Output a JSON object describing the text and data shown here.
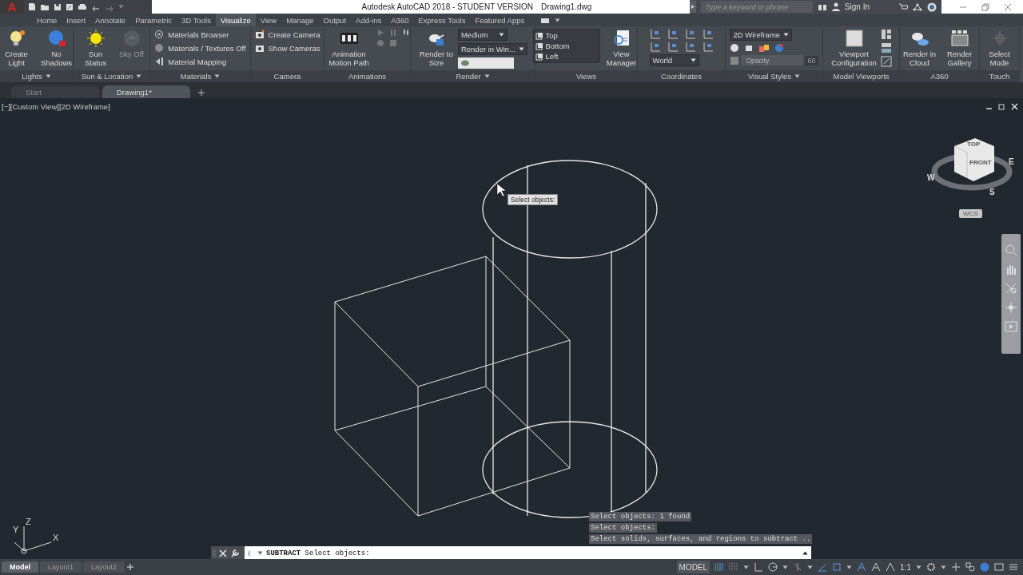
{
  "title_bar": {
    "app_button": "A",
    "title": "Autodesk AutoCAD 2018 - STUDENT VERSION",
    "file_name": "Drawing1.dwg",
    "search": {
      "placeholder": "Type a keyword or phrase"
    },
    "sign_in": "Sign In"
  },
  "ribbon_tabs": [
    {
      "label": "Home",
      "selected": false
    },
    {
      "label": "Insert",
      "selected": false
    },
    {
      "label": "Annotate",
      "selected": false
    },
    {
      "label": "Parametric",
      "selected": false
    },
    {
      "label": "3D Tools",
      "selected": false
    },
    {
      "label": "Visualize",
      "selected": true
    },
    {
      "label": "View",
      "selected": false
    },
    {
      "label": "Manage",
      "selected": false
    },
    {
      "label": "Output",
      "selected": false
    },
    {
      "label": "Add-ins",
      "selected": false
    },
    {
      "label": "A360",
      "selected": false
    },
    {
      "label": "Express Tools",
      "selected": false
    },
    {
      "label": "Featured Apps",
      "selected": false
    }
  ],
  "ribbon_panels": [
    {
      "title": "Lights",
      "menu": true,
      "items": [
        {
          "kind": "large",
          "label": "Create Light",
          "disabled": false
        },
        {
          "kind": "large",
          "label": "No Shadows",
          "disabled": false
        }
      ]
    },
    {
      "title": "Sun & Location",
      "menu": true,
      "items": [
        {
          "kind": "large",
          "label": "Sun Status",
          "disabled": false
        },
        {
          "kind": "large",
          "label": "Sky Off",
          "disabled": true
        }
      ]
    },
    {
      "title": "Materials",
      "menu": true,
      "items": [
        {
          "kind": "small",
          "label": "Materials Browser",
          "disabled": false
        },
        {
          "kind": "small",
          "label": "Materials / Textures Off",
          "disabled": false
        },
        {
          "kind": "small",
          "label": "Material Mapping",
          "disabled": false
        }
      ]
    },
    {
      "title": "Camera",
      "menu": false,
      "items": [
        {
          "kind": "small",
          "label": "Create Camera",
          "disabled": false
        },
        {
          "kind": "small",
          "label": "Show Cameras",
          "disabled": false
        }
      ]
    },
    {
      "title": "Animations",
      "menu": false,
      "items": [
        {
          "kind": "large",
          "label": "Animation Motion Path",
          "disabled": false
        },
        {
          "kind": "playback"
        }
      ]
    },
    {
      "title": "Render",
      "menu": true,
      "items": [
        {
          "kind": "large",
          "label": "Render to Size",
          "disabled": false
        },
        {
          "kind": "dropdown",
          "value": "Medium",
          "disabled": false
        },
        {
          "kind": "dropdown",
          "value": "Render in Win...",
          "disabled": false
        },
        {
          "kind": "field"
        }
      ]
    },
    {
      "title": "Views",
      "menu": false,
      "items": [
        {
          "kind": "list",
          "entries": [
            "Top",
            "Bottom",
            "Left"
          ]
        },
        {
          "kind": "large",
          "label": "View Manager",
          "disabled": false
        }
      ]
    },
    {
      "title": "Coordinates",
      "menu": false,
      "items": [
        {
          "kind": "axes_grid"
        },
        {
          "kind": "dropdown",
          "value": "World",
          "disabled": false
        }
      ]
    },
    {
      "title": "Visual Styles",
      "menu": true,
      "items": [
        {
          "kind": "dropdown",
          "value": "2D Wireframe",
          "disabled": false
        },
        {
          "kind": "style_icons"
        },
        {
          "kind": "slider",
          "label": "Opacity",
          "reading": "60",
          "disabled": true
        }
      ]
    },
    {
      "title": "Model Viewports",
      "menu": false,
      "items": [
        {
          "kind": "large",
          "label": "Viewport Configuration",
          "disabled": false
        },
        {
          "kind": "icon_column"
        }
      ]
    },
    {
      "title": "A360",
      "menu": false,
      "items": [
        {
          "kind": "large",
          "label": "Render in Cloud",
          "disabled": false
        },
        {
          "kind": "large",
          "label": "Render Gallery",
          "disabled": false
        }
      ]
    },
    {
      "title": "Touch",
      "menu": false,
      "items": [
        {
          "kind": "large",
          "label": "Select Mode",
          "disabled": false
        }
      ]
    }
  ],
  "file_tabs": [
    {
      "label": "Start",
      "selected": false
    },
    {
      "label": "Drawing1*",
      "selected": true
    }
  ],
  "viewport": {
    "label": "[−][Custom View][2D Wireframe]",
    "tooltip": "Select objects:",
    "view_cube": {
      "faces": [
        "TOP",
        "FRONT"
      ],
      "compass": [
        "W",
        "S",
        "E"
      ],
      "coordinate_system": "WCS"
    },
    "ucs_axes": [
      "X",
      "Y",
      "Z"
    ]
  },
  "command_history": [
    "Select objects: 1 found",
    "Select objects:",
    "Select solids, surfaces, and regions to subtract .."
  ],
  "command_line": {
    "prompt": "**SUBTRACT** Select objects:"
  },
  "layout_tabs": [
    {
      "label": "Model",
      "selected": true
    },
    {
      "label": "Layout1",
      "selected": false
    },
    {
      "label": "Layout2",
      "selected": false
    }
  ],
  "status_bar": {
    "space": "MODEL",
    "scale": "1:1"
  }
}
